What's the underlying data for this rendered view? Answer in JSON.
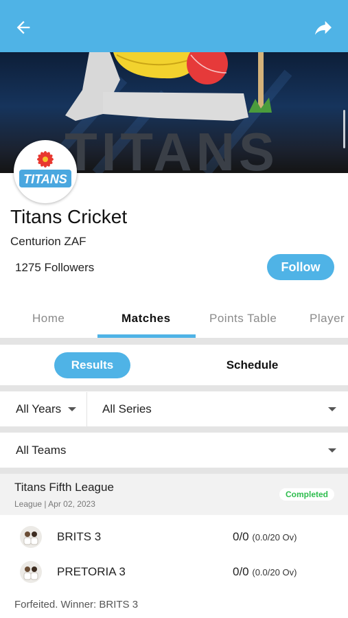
{
  "header": {
    "back_icon": "arrow-left-icon",
    "share_icon": "share-icon",
    "color": "#4fb3e6"
  },
  "team": {
    "name": "Titans Cricket",
    "location": "Centurion ZAF",
    "followers": "1275 Followers",
    "follow_label": "Follow",
    "banner_text": "TITANS",
    "logo_text": "TITANS"
  },
  "tabs": [
    {
      "label": "Home",
      "active": false
    },
    {
      "label": "Matches",
      "active": true
    },
    {
      "label": "Points Table",
      "active": false
    },
    {
      "label": "Player",
      "active": false
    }
  ],
  "toggle": {
    "results_label": "Results",
    "schedule_label": "Schedule"
  },
  "filters": {
    "years": "All Years",
    "series": "All Series",
    "teams": "All Teams"
  },
  "match": {
    "league": "Titans Fifth League",
    "meta": "League | Apr 02, 2023",
    "status": "Completed",
    "status_color": "#2ebd4e",
    "teams": [
      {
        "name": "BRITS 3",
        "score": "0/0",
        "overs": "(0.0/20 Ov)"
      },
      {
        "name": "PRETORIA 3",
        "score": "0/0",
        "overs": "(0.0/20 Ov)"
      }
    ],
    "result": "Forfeited. Winner: BRITS 3"
  }
}
